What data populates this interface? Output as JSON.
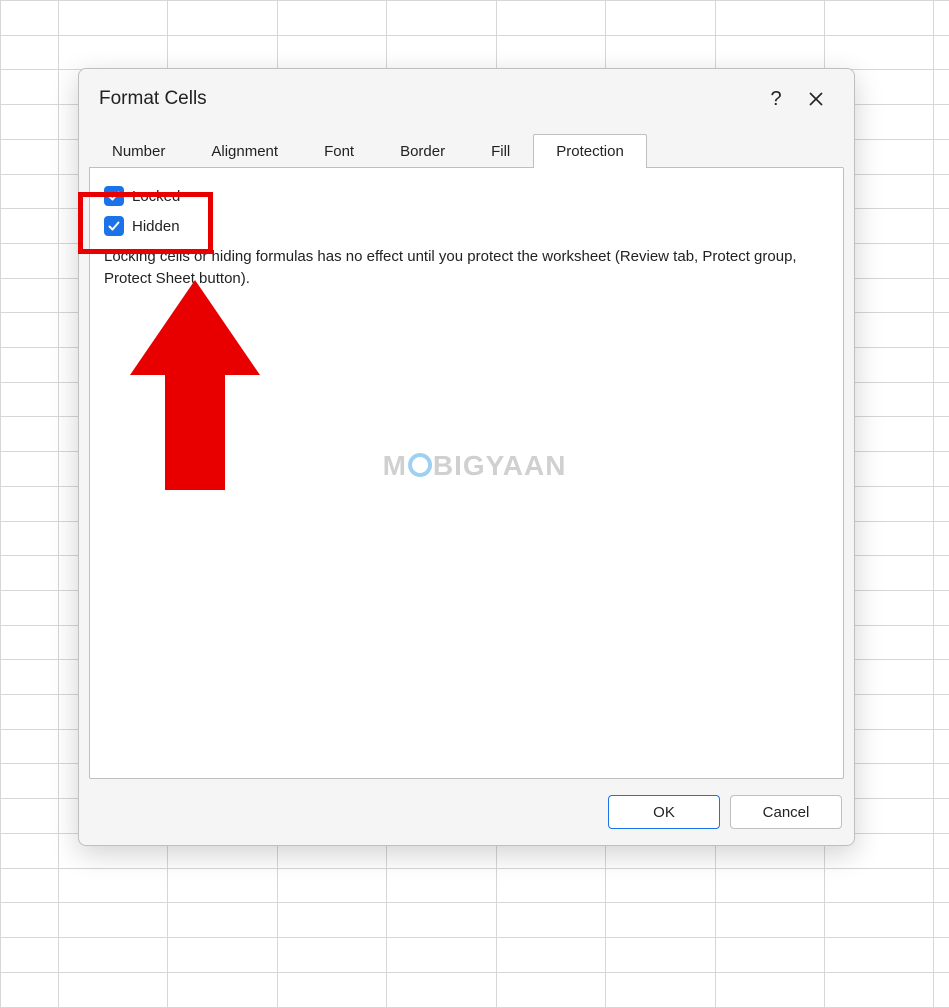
{
  "dialog": {
    "title": "Format Cells",
    "help_label": "?",
    "tabs": {
      "number": "Number",
      "alignment": "Alignment",
      "font": "Font",
      "border": "Border",
      "fill": "Fill",
      "protection": "Protection"
    },
    "protection": {
      "locked_label": "Locked",
      "locked_checked": true,
      "hidden_label": "Hidden",
      "hidden_checked": true,
      "description": "Locking cells or hiding formulas has no effect until you protect the worksheet (Review tab, Protect group, Protect Sheet button)."
    },
    "buttons": {
      "ok": "OK",
      "cancel": "Cancel"
    }
  },
  "watermark_left": "M",
  "watermark_right": "BIGYAAN",
  "colors": {
    "accent": "#1a73e8",
    "highlight": "#e80000"
  }
}
